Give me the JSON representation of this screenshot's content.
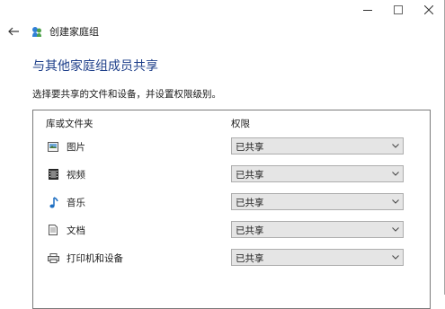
{
  "window": {
    "title": "创建家庭组",
    "buttons": {
      "minimize": "minimize-icon",
      "maximize": "maximize-icon",
      "close": "close-icon"
    }
  },
  "nav": {
    "back_icon": "back-arrow-icon",
    "app_icon": "homegroup-icon"
  },
  "content": {
    "heading": "与其他家庭组成员共享",
    "instruction": "选择要共享的文件和设备，并设置权限级别。"
  },
  "table": {
    "columns": [
      "库或文件夹",
      "权限"
    ],
    "rows": [
      {
        "label": "图片",
        "icon": "pictures-icon",
        "permission": "已共享"
      },
      {
        "label": "视频",
        "icon": "videos-icon",
        "permission": "已共享"
      },
      {
        "label": "音乐",
        "icon": "music-icon",
        "permission": "已共享"
      },
      {
        "label": "文档",
        "icon": "documents-icon",
        "permission": "已共享"
      },
      {
        "label": "打印机和设备",
        "icon": "printer-icon",
        "permission": "已共享"
      }
    ]
  },
  "colors": {
    "heading": "#1e3f8a",
    "select_bg": "#e5e5e5",
    "select_border": "#adadad",
    "panel_border": "#7a7a7a"
  }
}
